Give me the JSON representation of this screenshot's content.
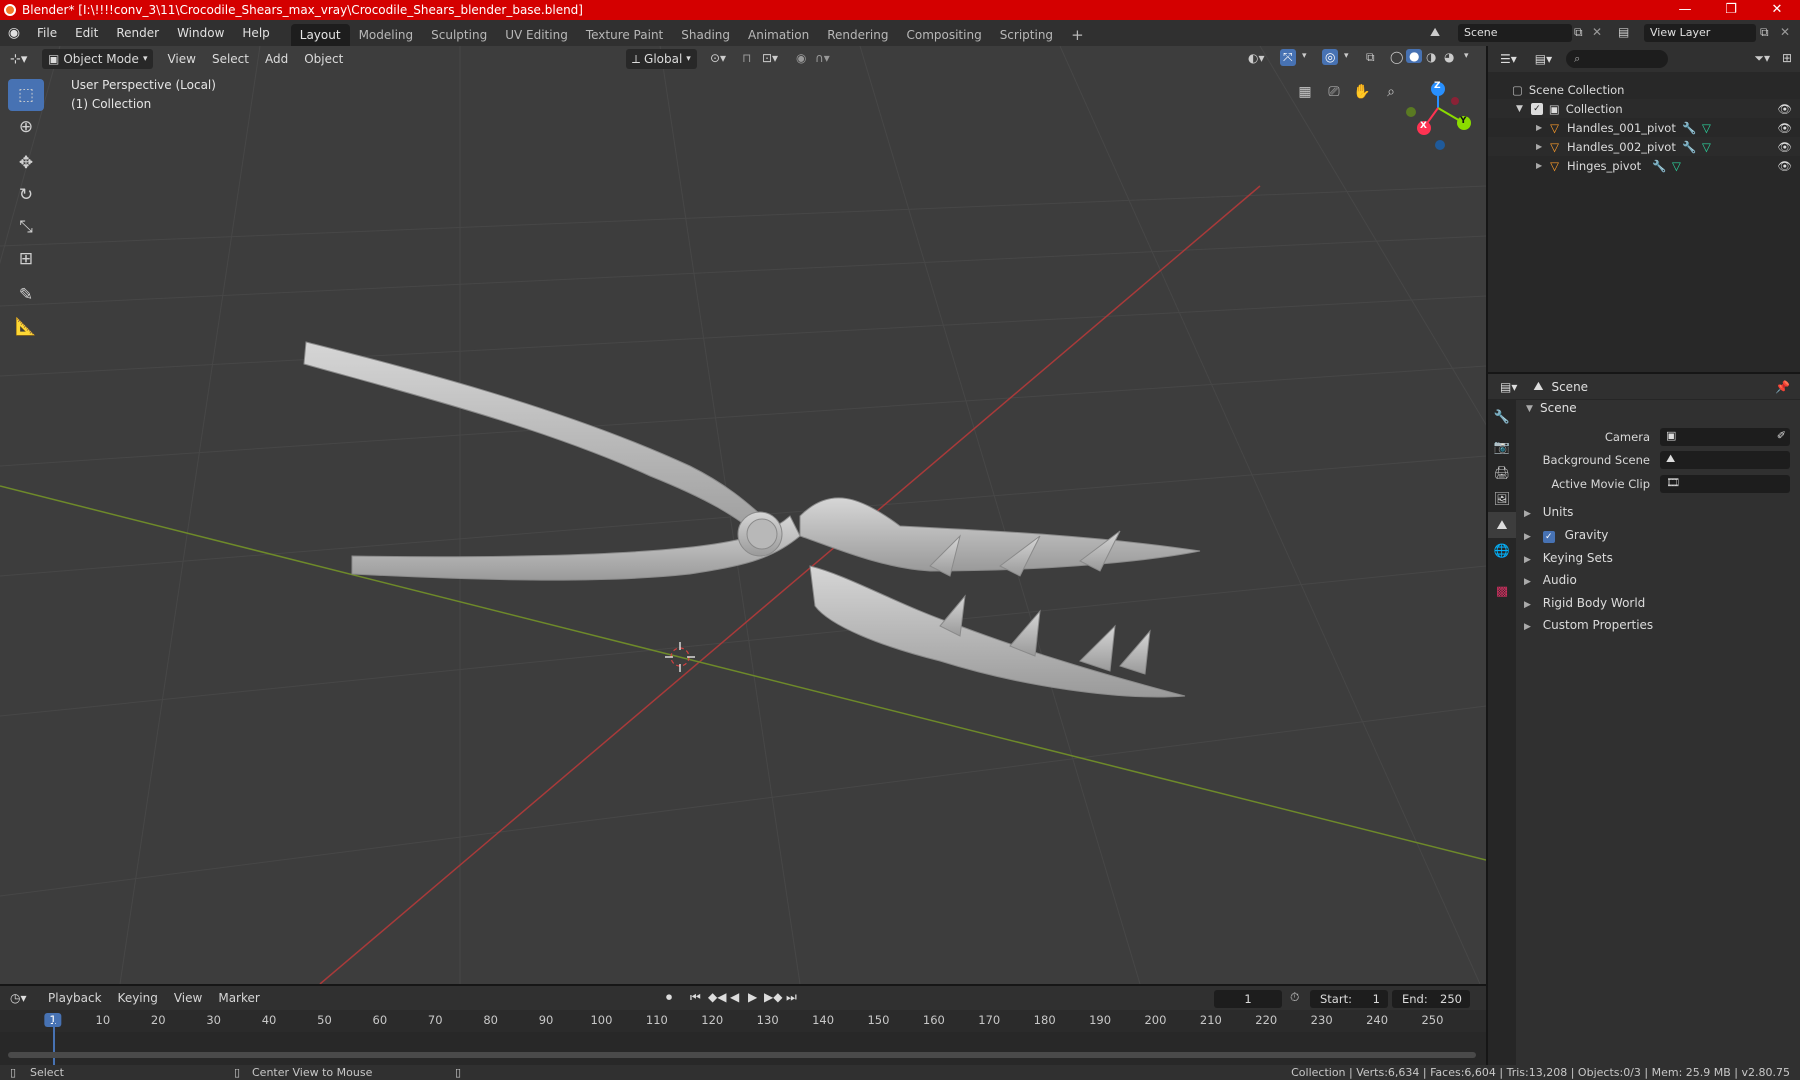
{
  "window": {
    "title": "Blender* [I:\\!!!!conv_3\\11\\Crocodile_Shears_max_vray\\Crocodile_Shears_blender_base.blend]",
    "controls": [
      "—",
      "❐",
      "✕"
    ]
  },
  "topbar": {
    "menus": [
      "File",
      "Edit",
      "Render",
      "Window",
      "Help"
    ],
    "workspaces": [
      "Layout",
      "Modeling",
      "Sculpting",
      "UV Editing",
      "Texture Paint",
      "Shading",
      "Animation",
      "Rendering",
      "Compositing",
      "Scripting"
    ],
    "active_workspace": "Layout",
    "add_workspace": "+",
    "scene_name": "Scene",
    "view_layer": "View Layer"
  },
  "viewport": {
    "mode": "Object Mode",
    "menus": [
      "View",
      "Select",
      "Add",
      "Object"
    ],
    "transform_orientation": "Global",
    "overlay_text_1": "User Perspective (Local)",
    "overlay_text_2": "(1) Collection",
    "gizmo_axes": {
      "x": "X",
      "y": "Y",
      "z": "Z"
    },
    "colors": {
      "x_axis": "#ff3352",
      "y_axis": "#8bdc00",
      "z_axis": "#2890ff",
      "accent": "#4772b3"
    }
  },
  "outliner": {
    "search_placeholder": "",
    "root": "Scene Collection",
    "collection": "Collection",
    "objects": [
      {
        "name": "Handles_001_pivot"
      },
      {
        "name": "Handles_002_pivot"
      },
      {
        "name": "Hinges_pivot"
      }
    ]
  },
  "properties": {
    "context": "Scene",
    "panel_title": "Scene",
    "fields": {
      "camera_label": "Camera",
      "background_scene_label": "Background Scene",
      "active_movie_clip_label": "Active Movie Clip"
    },
    "sections": [
      "Units",
      "Gravity",
      "Keying Sets",
      "Audio",
      "Rigid Body World",
      "Custom Properties"
    ],
    "gravity_checked": true
  },
  "timeline": {
    "menus": [
      "Playback",
      "Keying",
      "View",
      "Marker"
    ],
    "current_frame": "1",
    "start_label": "Start:",
    "start_value": "1",
    "end_label": "End:",
    "end_value": "250",
    "frame_ticks": [
      "1",
      "10",
      "20",
      "30",
      "40",
      "50",
      "60",
      "70",
      "80",
      "90",
      "100",
      "110",
      "120",
      "130",
      "140",
      "150",
      "160",
      "170",
      "180",
      "190",
      "200",
      "210",
      "220",
      "230",
      "240",
      "250"
    ]
  },
  "statusbar": {
    "select_hint": "Select",
    "center_hint": "Center View to Mouse",
    "stats": "Collection | Verts:6,634 | Faces:6,604 | Tris:13,208 | Objects:0/3 | Mem: 25.9 MB | v2.80.75"
  }
}
